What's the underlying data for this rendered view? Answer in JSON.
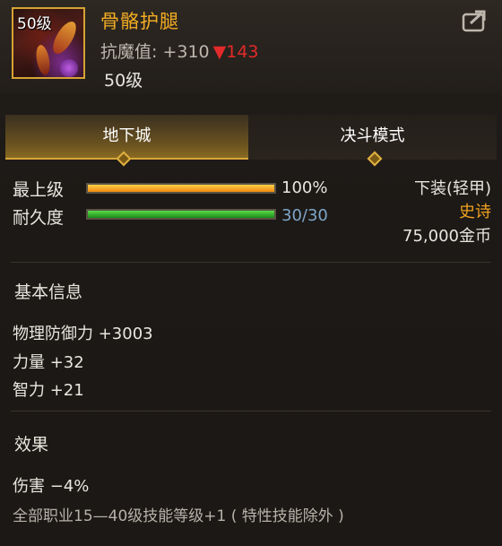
{
  "item": {
    "level_badge": "50级",
    "name": "骨骼护腿",
    "stat_label": "抗魔值: +310",
    "stat_change": "▼143",
    "required_level": "50级"
  },
  "tabs": [
    {
      "label": "地下城",
      "active": true
    },
    {
      "label": "决斗模式",
      "active": false
    }
  ],
  "bars": {
    "upgrade": {
      "label": "最上级",
      "percent_text": "100%",
      "fill": 1.0
    },
    "durability": {
      "label": "耐久度",
      "value_text": "30/30",
      "fill": 1.0
    }
  },
  "meta": {
    "slot": "下装(轻甲)",
    "rarity": "史诗",
    "price": "75,000金币"
  },
  "basic_info": {
    "title": "基本信息",
    "attrs": [
      "物理防御力 +3003",
      "力量 +32",
      "智力 +21"
    ]
  },
  "effects": {
    "title": "效果",
    "lines": [
      "伤害 −4%"
    ],
    "note": "全部职业15—40级技能等级+1 ( 特性技能除外 )"
  },
  "colors": {
    "name_gold": "#f3ad23",
    "rarity_orange": "#f0a020",
    "stat_down_red": "#e22a2a",
    "durability_blue": "#7ea6c9"
  }
}
